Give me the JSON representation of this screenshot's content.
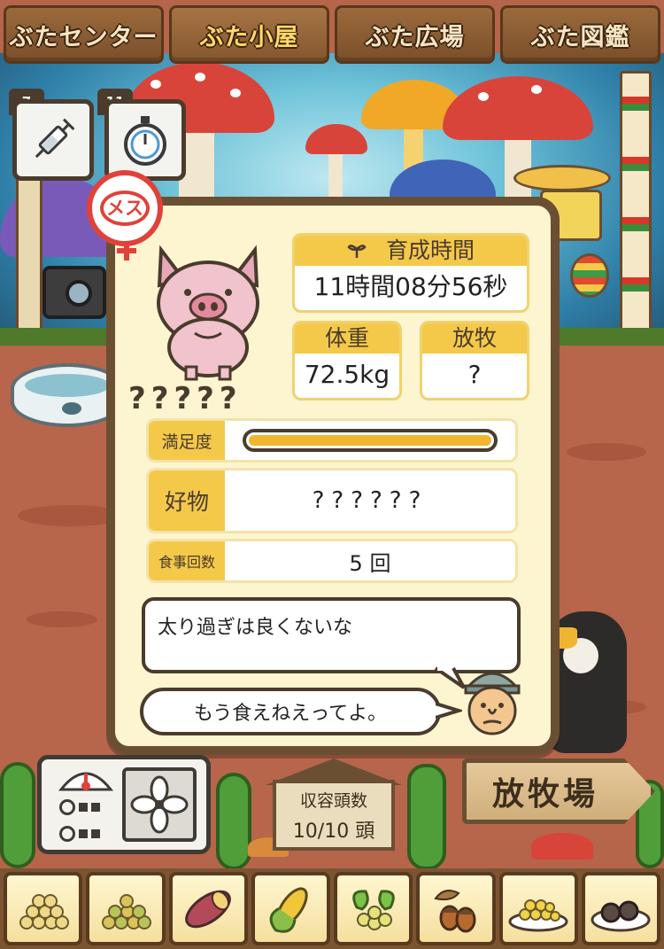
{
  "nav": {
    "tabs": [
      {
        "label": "ぶたセンター",
        "active": false
      },
      {
        "label": "ぶた小屋",
        "active": true
      },
      {
        "label": "ぶた広場",
        "active": false
      },
      {
        "label": "ぶた図鑑",
        "active": false
      }
    ]
  },
  "items": {
    "syringe_count": "7",
    "stopwatch_count": "11"
  },
  "pig": {
    "gender_label": "メス",
    "name": "?????",
    "growth_time_label": "育成時間",
    "growth_time_value": "11時間08分56秒",
    "weight_label": "体重",
    "weight_value": "72.5kg",
    "grazing_label": "放牧",
    "grazing_value": "?",
    "satisfaction_label": "満足度",
    "satisfaction_level": 1.0,
    "favorite_label": "好物",
    "favorite_value": "??????",
    "meals_label": "食事回数",
    "meals_value": "5 回"
  },
  "dialog": {
    "pig_message": "太り過ぎは良くないな",
    "farmer_message": "もう食えねえってよ。"
  },
  "bottom": {
    "capacity_label": "収容頭数",
    "capacity_value": "10/10 頭",
    "pasture_label": "放牧場"
  },
  "food_icons": [
    "grain-pile-icon",
    "mixed-grain-icon",
    "sweet-potato-icon",
    "corn-icon",
    "vegetables-icon",
    "acorn-icon",
    "grain-plate-icon",
    "meatball-plate-icon"
  ],
  "colors": {
    "panel_bg": "#fcf5d0",
    "accent_yellow": "#f4c94a",
    "panel_border": "#6a4f33",
    "female_red": "#e0423a"
  }
}
